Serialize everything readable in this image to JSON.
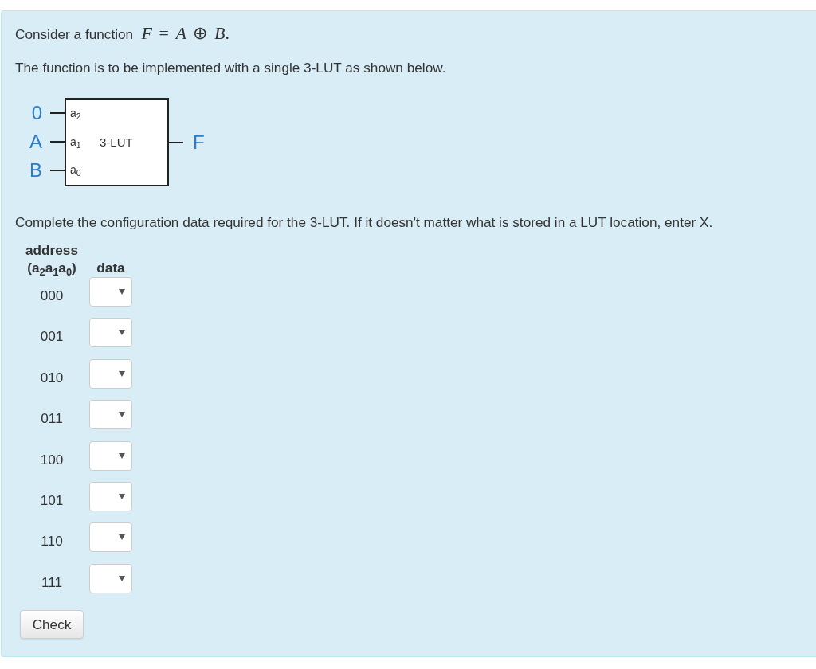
{
  "question": {
    "text": "Consider a function",
    "formula": "*F* = *A* ⊕ *B*."
  },
  "statement": "The function is to be implemented with a single 3-LUT as shown below.",
  "diagram": {
    "inputs": [
      {
        "signal": "0",
        "pin": "a$_{2}$"
      },
      {
        "signal": "A",
        "pin": "a$_{1}$"
      },
      {
        "signal": "B",
        "pin": "a$_{0}$"
      }
    ],
    "block": "3-LUT",
    "output": "F"
  },
  "instruction": "Complete the configuration data required for the 3-LUT. If it doesn't matter what is stored in a LUT location, enter X.",
  "table": {
    "columns": [
      {
        "heading": "address",
        "subheading": "(a$_{2}$a$_{1}$a$_{0}$)"
      },
      {
        "heading": "data"
      }
    ],
    "rows": [
      {
        "address": "000"
      },
      {
        "address": "001"
      },
      {
        "address": "010"
      },
      {
        "address": "011"
      },
      {
        "address": "100"
      },
      {
        "address": "101"
      },
      {
        "address": "110"
      },
      {
        "address": "111"
      }
    ]
  },
  "button": "Check"
}
